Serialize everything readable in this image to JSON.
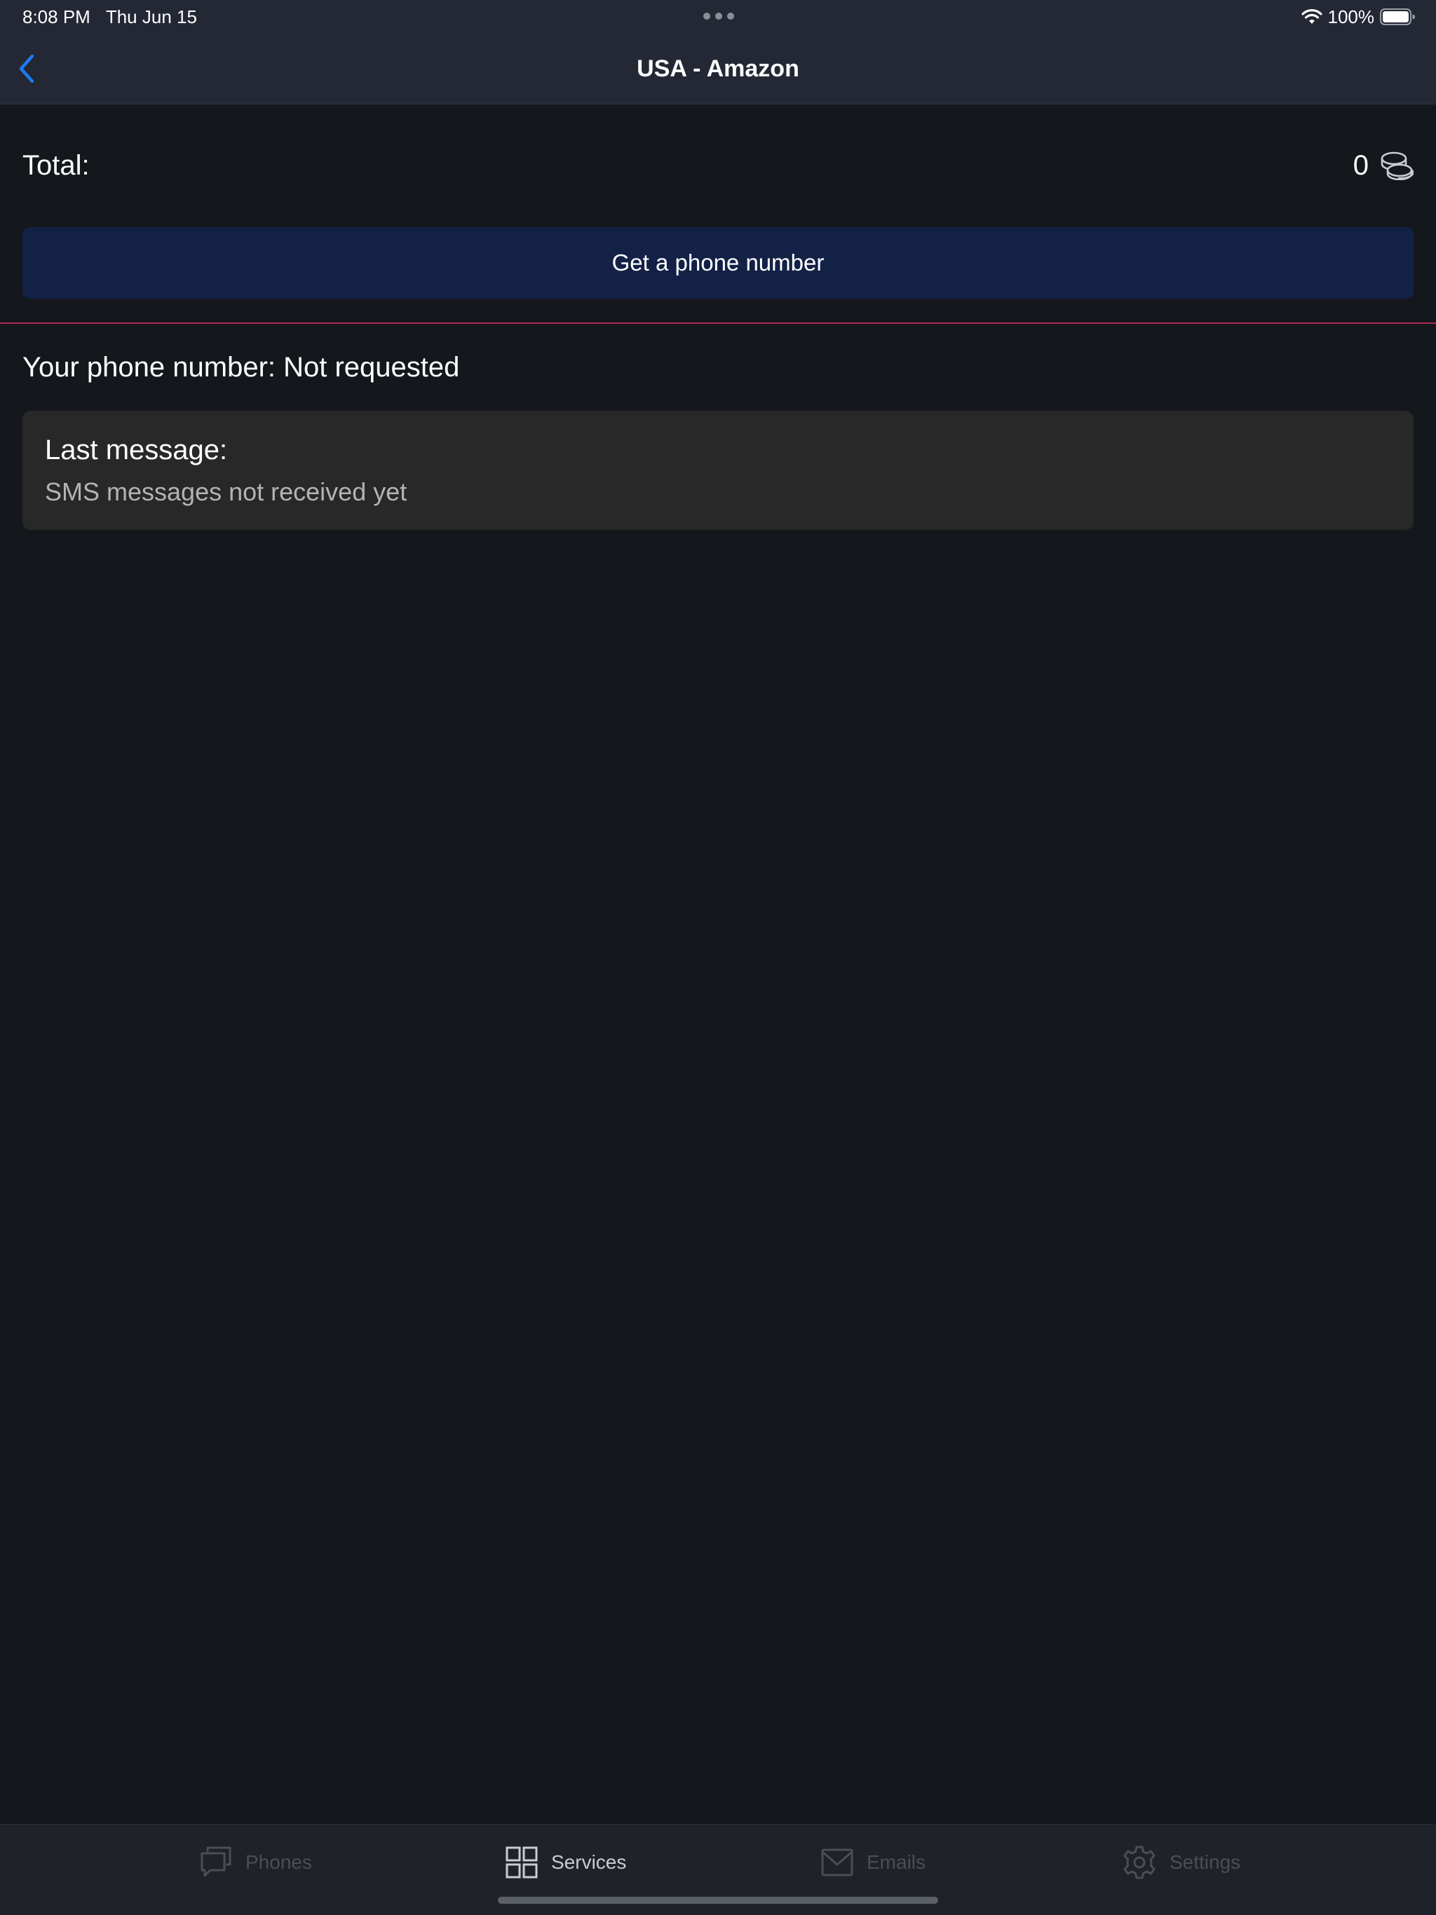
{
  "status_bar": {
    "time": "8:08 PM",
    "date": "Thu Jun 15",
    "battery": "100%",
    "icons": [
      "wifi-icon",
      "battery-icon"
    ]
  },
  "header": {
    "title": "USA - Amazon",
    "back_icon": "chevron-left-icon"
  },
  "total": {
    "label": "Total:",
    "value": "0",
    "icon": "coins-icon"
  },
  "actions": {
    "get_number_label": "Get a phone number"
  },
  "phone": {
    "line": "Your phone number: Not requested"
  },
  "last_message": {
    "title": "Last message:",
    "body": "SMS messages not received yet"
  },
  "tabs": [
    {
      "label": "Phones",
      "icon": "chat-bubbles-icon",
      "active": false
    },
    {
      "label": "Services",
      "icon": "grid-icon",
      "active": true
    },
    {
      "label": "Emails",
      "icon": "envelope-icon",
      "active": false
    },
    {
      "label": "Settings",
      "icon": "gear-icon",
      "active": false
    }
  ],
  "colors": {
    "background": "#14171c",
    "header": "#232834",
    "accent": "#1a7cf5",
    "button": "#132146",
    "divider": "#b02a57",
    "card": "#282828"
  }
}
